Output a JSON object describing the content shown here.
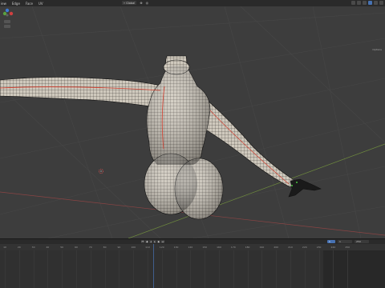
{
  "menu": [
    "View",
    "Select",
    "Add",
    "Mesh",
    "Vertex",
    "Edge",
    "Face",
    "UV"
  ],
  "menu_visible": [
    "iew",
    "Edge",
    "Face",
    "UV"
  ],
  "header": {
    "transform_orientation": "Global"
  },
  "viewport": {
    "options_label": "Options",
    "axis_labels": [
      "X",
      "Y",
      "Z"
    ]
  },
  "timeline": {
    "current_frame": "1",
    "start_frame": "1",
    "end_frame": "250",
    "ruler_ticks": [
      "10",
      "20",
      "30",
      "40",
      "50",
      "60",
      "70",
      "80",
      "90",
      "100",
      "110",
      "120",
      "130",
      "140",
      "150",
      "160",
      "170",
      "180",
      "190",
      "200",
      "210",
      "220",
      "230",
      "240",
      "250"
    ]
  },
  "colors": {
    "accent": "#4772b3",
    "background": "#3d3d3d",
    "mesh": "#cfc9bd",
    "wire": "#1a1a1a",
    "seam": "#d23a2a"
  }
}
